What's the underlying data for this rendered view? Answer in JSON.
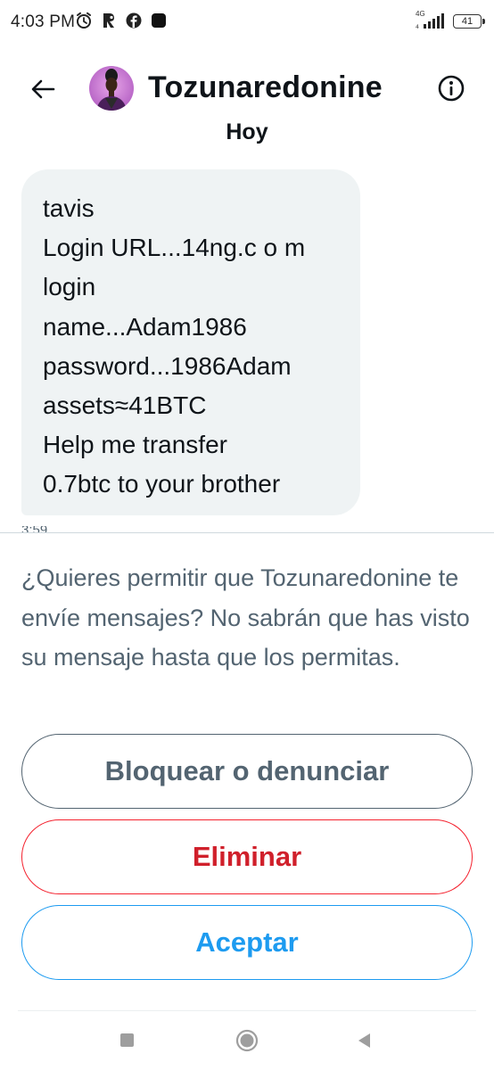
{
  "status_bar": {
    "time": "4:03 PM",
    "network": "4G",
    "battery": "41",
    "icons": [
      "alarm-icon",
      "r-app-icon",
      "facebook-icon",
      "app-square-icon",
      "signal-icon",
      "battery-icon"
    ]
  },
  "header": {
    "contact_name": "Tozunaredonine",
    "back_icon": "back-arrow-icon",
    "info_icon": "info-icon"
  },
  "conversation": {
    "date_label": "Hoy",
    "message": {
      "lines": [
        "tavis",
        "Login URL...14ng.c o m",
        "login",
        "name...Adam1986",
        "password...1986Adam",
        "assets≈41BTC",
        "Help me transfer",
        "0.7btc to your brother"
      ],
      "time_partial": "3:59"
    }
  },
  "permission": {
    "text": "¿Quieres permitir que Tozunaredonine te envíe mensajes? No sabrán que has visto su mensaje hasta que los permitas.",
    "block_label": "Bloquear o denunciar",
    "delete_label": "Eliminar",
    "accept_label": "Aceptar"
  },
  "colors": {
    "accent": "#1d9bf0",
    "danger": "#f4212e",
    "muted": "#536471",
    "bubble": "#eff3f4",
    "text": "#0f1419"
  },
  "nav_bar": {
    "icons": [
      "recents-icon",
      "home-icon",
      "nav-back-icon"
    ]
  }
}
